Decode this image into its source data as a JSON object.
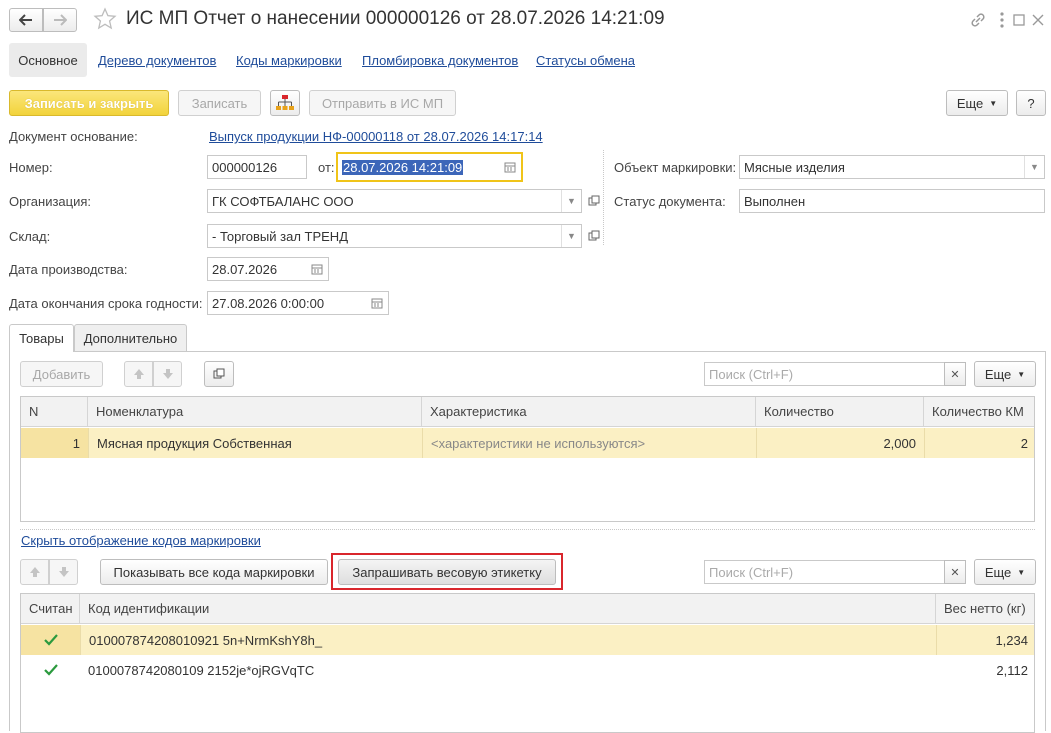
{
  "window": {
    "title": "ИС МП Отчет о нанесении 000000126 от 28.07.2026 14:21:09"
  },
  "nav": {
    "tabs": [
      {
        "label": "Основное"
      },
      {
        "label": "Дерево документов"
      },
      {
        "label": "Коды маркировки"
      },
      {
        "label": "Пломбировка документов"
      },
      {
        "label": "Статусы обмена"
      }
    ]
  },
  "toolbar": {
    "save_close": "Записать и закрыть",
    "save": "Записать",
    "send": "Отправить в ИС МП",
    "more": "Еще",
    "help": "?"
  },
  "form": {
    "basis_label": "Документ основание:",
    "basis_value": "Выпуск продукции НФ-00000118 от 28.07.2026 14:17:14",
    "number_label": "Номер:",
    "number_value": "000000126",
    "from_label": "от:",
    "date_value": "28.07.2026 14:21:09",
    "org_label": "Организация:",
    "org_value": "ГК СОФТБАЛАНС ООО",
    "warehouse_label": "Склад:",
    "warehouse_value": "- Торговый зал ТРЕНД",
    "prod_date_label": "Дата производства:",
    "prod_date_value": "28.07.2026",
    "expiry_label": "Дата окончания срока годности:",
    "expiry_value": "27.08.2026  0:00:00",
    "object_label": "Объект маркировки:",
    "object_value": "Мясные изделия",
    "status_label": "Статус документа:",
    "status_value": "Выполнен"
  },
  "tabs": {
    "goods": "Товары",
    "extra": "Дополнительно"
  },
  "goods": {
    "add": "Добавить",
    "search_placeholder": "Поиск (Ctrl+F)",
    "more": "Еще",
    "columns": [
      "N",
      "Номенклатура",
      "Характеристика",
      "Количество",
      "Количество КМ"
    ],
    "rows": [
      {
        "n": "1",
        "item": "Мясная продукция Собственная",
        "char": "<характеристики не используются>",
        "qty": "2,000",
        "qty_km": "2"
      }
    ]
  },
  "codes": {
    "hide_link": "Скрыть отображение кодов маркировки",
    "show_all": "Показывать все кода маркировки",
    "request_weight": "Запрашивать весовую этикетку",
    "search_placeholder": "Поиск (Ctrl+F)",
    "more": "Еще",
    "columns": [
      "Считан",
      "Код идентификации",
      "Вес нетто (кг)"
    ],
    "rows": [
      {
        "code": "010007874208010921 5n+NrmKshY8h_",
        "weight": "1,234"
      },
      {
        "code": "0100078742080109 2152je*ojRGVqTC",
        "weight": "2,112"
      }
    ]
  },
  "colors": {
    "accent_link": "#1f4c9a",
    "primary_button": "#f2d33b",
    "selected_row": "#fbf0c4",
    "highlight_box": "#d9262c",
    "check": "#2b9a3e"
  }
}
